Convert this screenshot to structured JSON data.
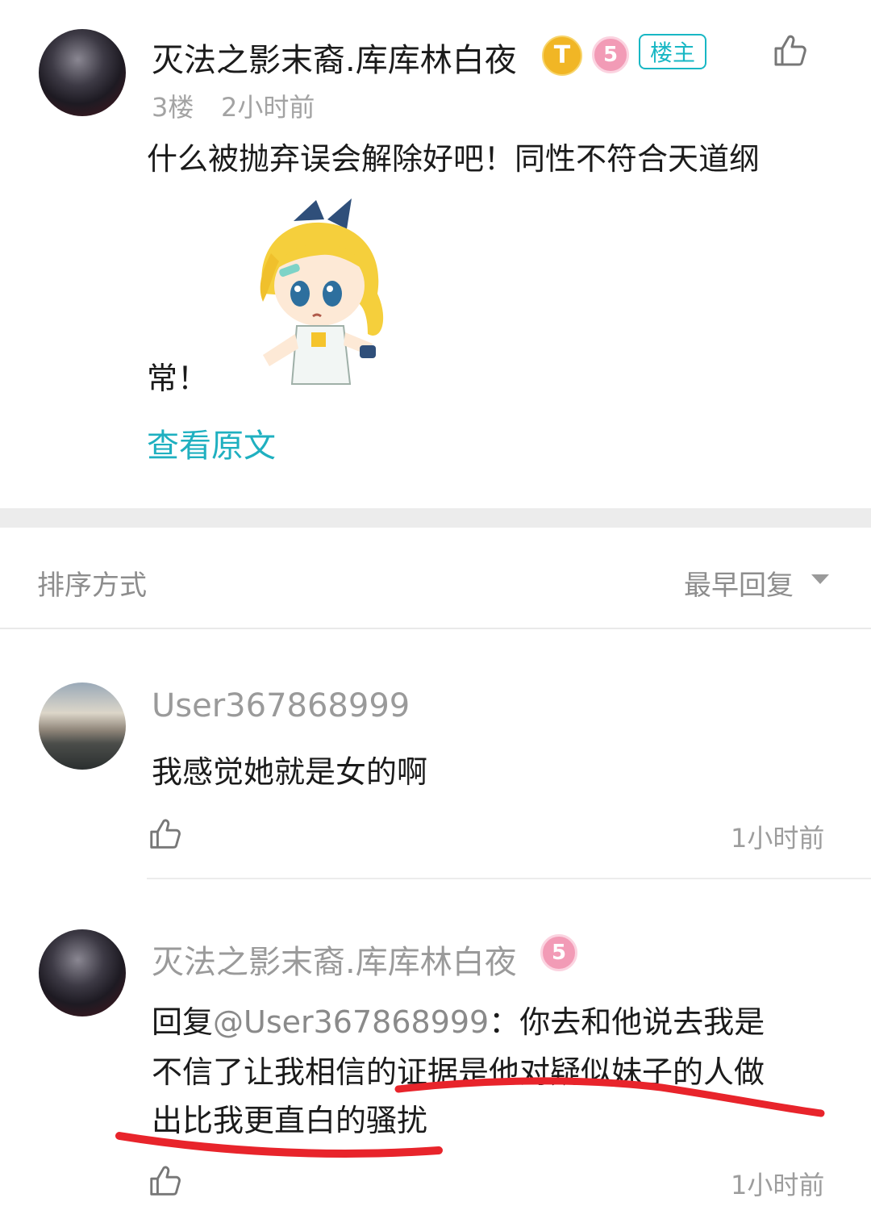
{
  "post": {
    "author": "灭法之影末裔.库库林白夜",
    "badge_t": "T",
    "badge_level": "5",
    "owner_tag": "楼主",
    "floor": "3楼",
    "time": "2小时前",
    "content_line1": "什么被抛弃误会解除好吧！同性不符合天道纲",
    "content_line2": "常！",
    "view_original": "查看原文",
    "icons": {
      "like": "thumbs-up-icon",
      "sticker": "anime-girl-sticker"
    }
  },
  "sort": {
    "label": "排序方式",
    "value": "最早回复"
  },
  "replies": [
    {
      "author": "User367868999",
      "content": "我感觉她就是女的啊",
      "time": "1小时前"
    },
    {
      "author": "灭法之影末裔.库库林白夜",
      "badge_level": "5",
      "reply_prefix": "回复",
      "mention": "@User367868999",
      "colon": "：",
      "line1_rest": "你去和他说去我是",
      "line2": "不信了让我相信的证据是他对疑似妹子的人做",
      "line3": "出比我更直白的骚扰",
      "time": "1小时前"
    }
  ],
  "colors": {
    "accent": "#1fb0c0",
    "annotation": "#e8242b"
  }
}
